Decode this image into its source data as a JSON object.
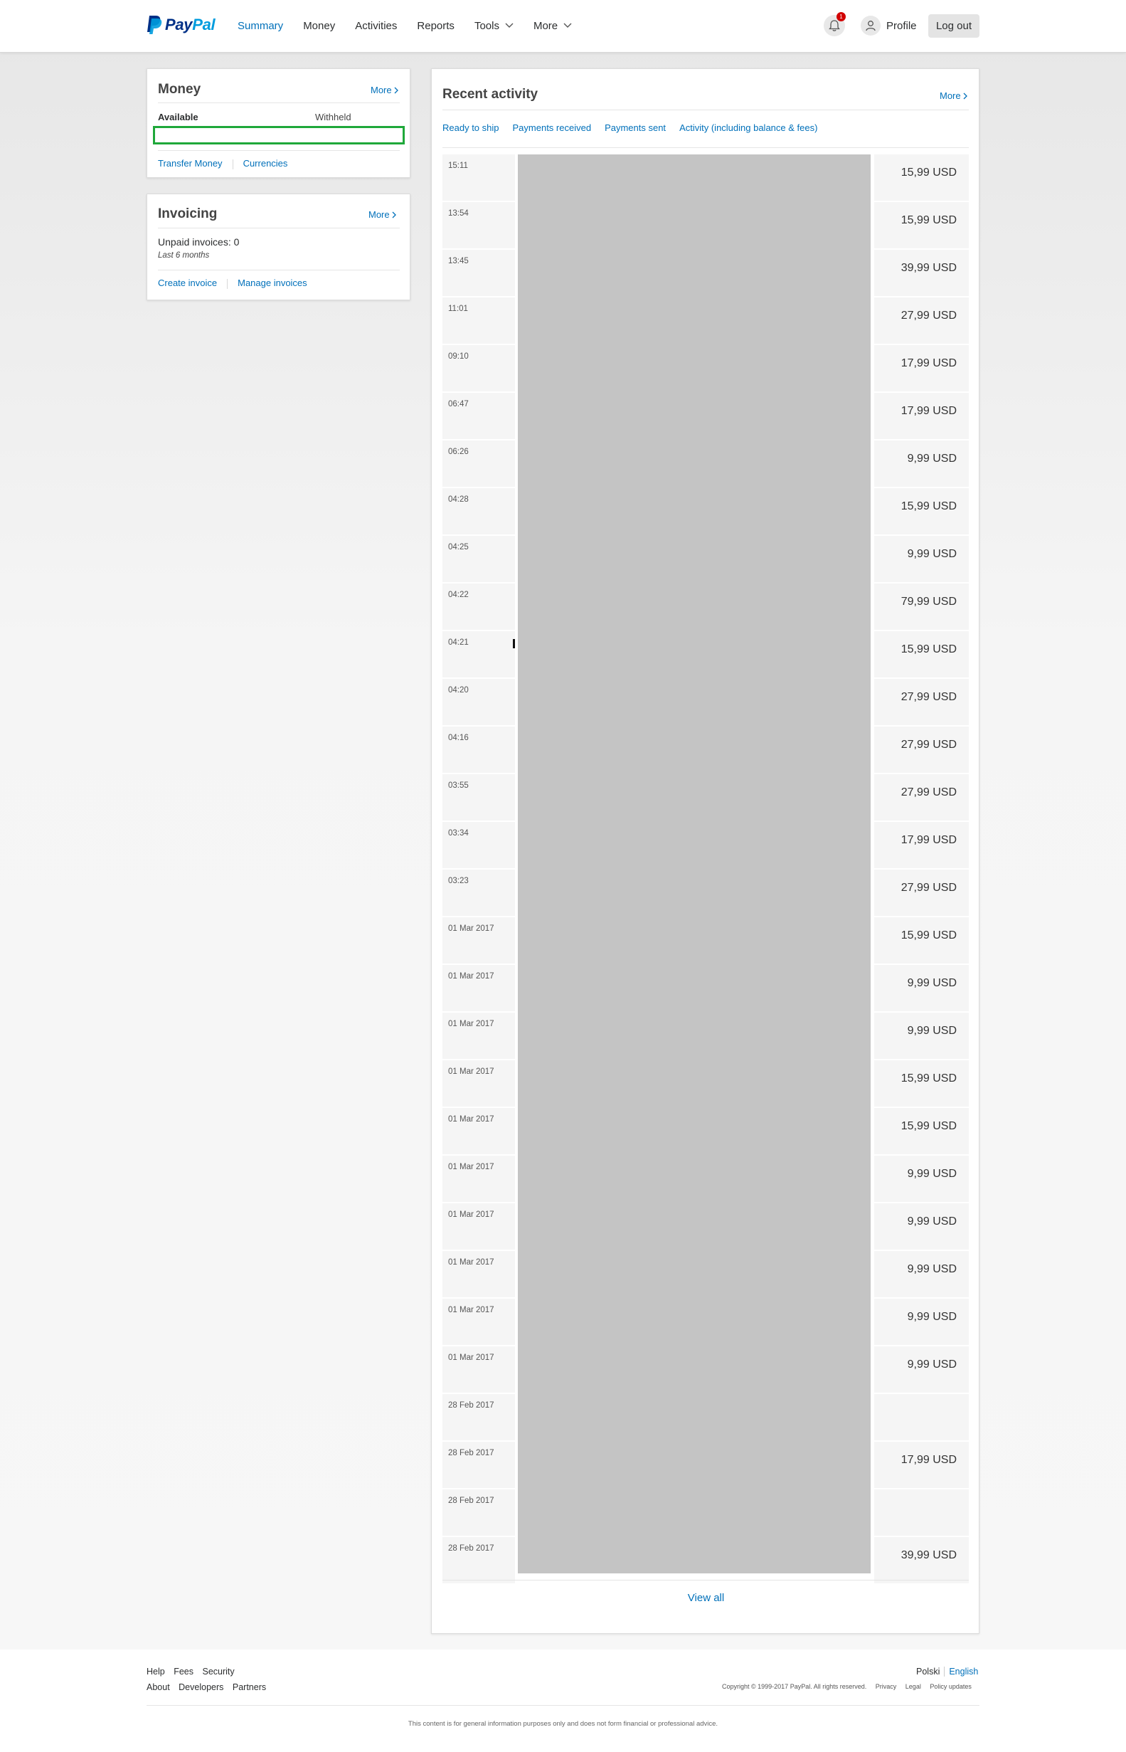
{
  "header": {
    "logo_text_pay": "Pay",
    "logo_text_pal": "Pal",
    "nav": [
      "Summary",
      "Money",
      "Activities",
      "Reports",
      "Tools",
      "More"
    ],
    "notification_count": "1",
    "profile_label": "Profile",
    "logout_label": "Log out"
  },
  "money": {
    "title": "Money",
    "more": "More",
    "available_label": "Available",
    "withheld_label": "Withheld",
    "links": [
      "Transfer Money",
      "Currencies"
    ]
  },
  "invoicing": {
    "title": "Invoicing",
    "more": "More",
    "unpaid": "Unpaid invoices: 0",
    "period": "Last 6 months",
    "links": [
      "Create invoice",
      "Manage invoices"
    ]
  },
  "activity": {
    "title": "Recent activity",
    "more": "More",
    "filters": [
      "Ready to ship",
      "Payments received",
      "Payments sent",
      "Activity (including balance & fees)"
    ],
    "rows": [
      {
        "date": "15:11",
        "amount": "15,99 USD"
      },
      {
        "date": "13:54",
        "amount": "15,99 USD"
      },
      {
        "date": "13:45",
        "amount": "39,99 USD"
      },
      {
        "date": "11:01",
        "amount": "27,99 USD"
      },
      {
        "date": "09:10",
        "amount": "17,99 USD"
      },
      {
        "date": "06:47",
        "amount": "17,99 USD"
      },
      {
        "date": "06:26",
        "amount": "9,99 USD"
      },
      {
        "date": "04:28",
        "amount": "15,99 USD"
      },
      {
        "date": "04:25",
        "amount": "9,99 USD"
      },
      {
        "date": "04:22",
        "amount": "79,99 USD"
      },
      {
        "date": "04:21",
        "amount": "15,99 USD"
      },
      {
        "date": "04:20",
        "amount": "27,99 USD"
      },
      {
        "date": "04:16",
        "amount": "27,99 USD"
      },
      {
        "date": "03:55",
        "amount": "27,99 USD"
      },
      {
        "date": "03:34",
        "amount": "17,99 USD"
      },
      {
        "date": "03:23",
        "amount": "27,99 USD"
      },
      {
        "date": "01 Mar 2017",
        "amount": "15,99 USD"
      },
      {
        "date": "01 Mar 2017",
        "amount": "9,99 USD"
      },
      {
        "date": "01 Mar 2017",
        "amount": "9,99 USD"
      },
      {
        "date": "01 Mar 2017",
        "amount": "15,99 USD"
      },
      {
        "date": "01 Mar 2017",
        "amount": "15,99 USD"
      },
      {
        "date": "01 Mar 2017",
        "amount": "9,99 USD"
      },
      {
        "date": "01 Mar 2017",
        "amount": "9,99 USD"
      },
      {
        "date": "01 Mar 2017",
        "amount": "9,99 USD"
      },
      {
        "date": "01 Mar 2017",
        "amount": "9,99 USD"
      },
      {
        "date": "01 Mar 2017",
        "amount": "9,99 USD"
      },
      {
        "date": "28 Feb 2017",
        "amount": ""
      },
      {
        "date": "28 Feb 2017",
        "amount": "17,99 USD"
      },
      {
        "date": "28 Feb 2017",
        "amount": ""
      },
      {
        "date": "28 Feb 2017",
        "amount": "39,99 USD"
      }
    ],
    "view_all": "View all"
  },
  "footer": {
    "links_row1": [
      "Help",
      "Fees",
      "Security"
    ],
    "links_row2": [
      "About",
      "Developers",
      "Partners"
    ],
    "languages": [
      "Polski",
      "English"
    ],
    "copyright": "Copyright © 1999-2017 PayPal. All rights reserved.",
    "legal_links": [
      "Privacy",
      "Legal",
      "Policy updates"
    ],
    "disclaimer": "This content is for general information purposes only and does not form financial or professional advice."
  },
  "colors": {
    "brand_dark": "#003087",
    "brand_light": "#009cde",
    "link": "#0070ba",
    "highlight_box": "#1fa83a",
    "redaction": "#c4c4c4"
  }
}
